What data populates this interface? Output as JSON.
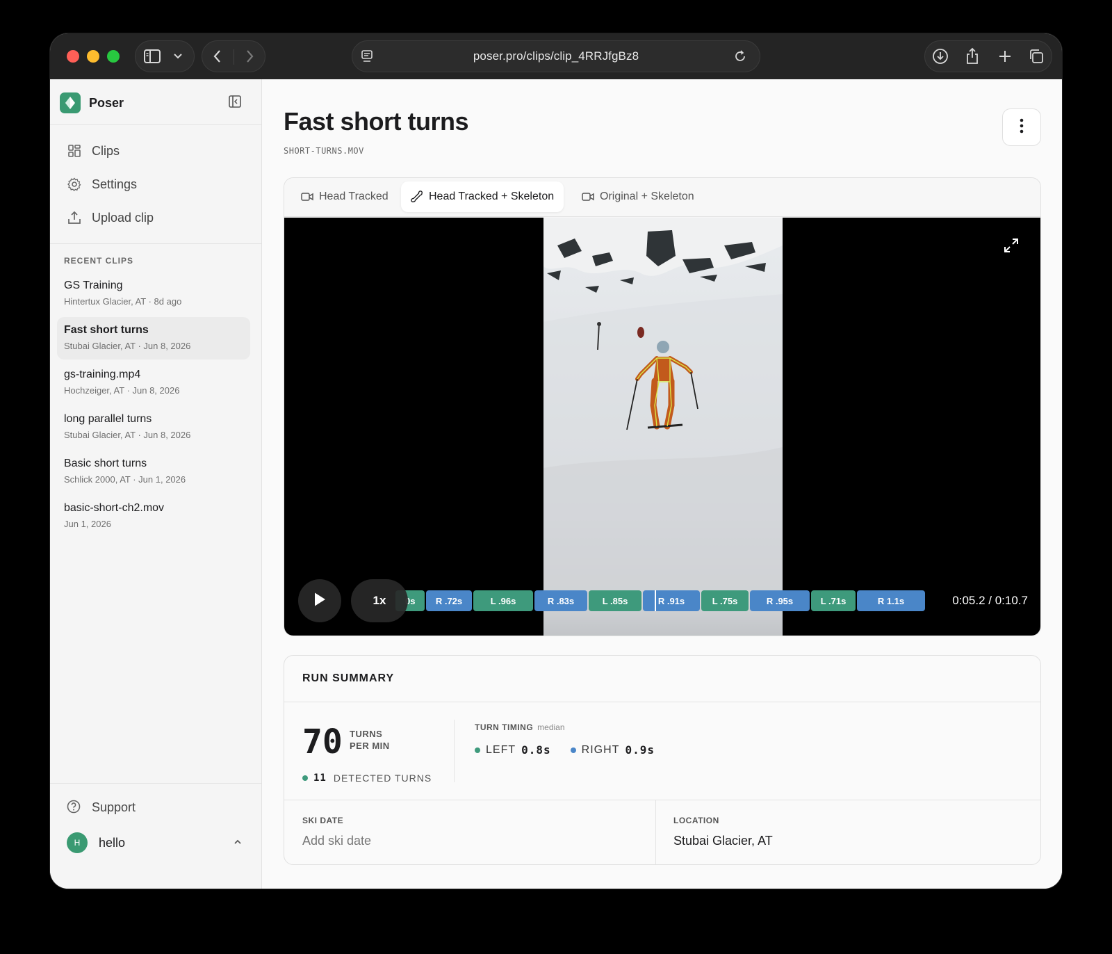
{
  "browser": {
    "url": "poser.pro/clips/clip_4RRJfgBz8"
  },
  "sidebar": {
    "brand": "Poser",
    "nav": [
      {
        "label": "Clips",
        "icon": "grid-icon"
      },
      {
        "label": "Settings",
        "icon": "gear-icon"
      },
      {
        "label": "Upload clip",
        "icon": "upload-icon"
      }
    ],
    "recent_heading": "RECENT CLIPS",
    "recent": [
      {
        "title": "GS Training",
        "sub": "Hintertux Glacier, AT · 8d ago",
        "active": false
      },
      {
        "title": "Fast short turns",
        "sub": "Stubai Glacier, AT · Jun 8, 2026",
        "active": true
      },
      {
        "title": "gs-training.mp4",
        "sub": "Hochzeiger, AT · Jun 8, 2026",
        "active": false
      },
      {
        "title": "long parallel turns",
        "sub": "Stubai Glacier, AT · Jun 8, 2026",
        "active": false
      },
      {
        "title": "Basic short turns",
        "sub": "Schlick 2000, AT · Jun 1, 2026",
        "active": false
      },
      {
        "title": "basic-short-ch2.mov",
        "sub": "Jun 1, 2026",
        "active": false
      }
    ],
    "support": "Support",
    "user": {
      "initial": "H",
      "name": "hello"
    }
  },
  "main": {
    "title": "Fast short turns",
    "filename": "SHORT-TURNS.MOV",
    "tabs": [
      {
        "label": "Head Tracked",
        "icon": "video-camera-icon",
        "active": false
      },
      {
        "label": "Head Tracked + Skeleton",
        "icon": "bone-icon",
        "active": true
      },
      {
        "label": "Original + Skeleton",
        "icon": "video-camera-icon",
        "active": false
      }
    ],
    "player": {
      "speed": "1x",
      "time": "0:05.2 / 0:10.7",
      "turns": [
        {
          "label": "0s",
          "side": "L"
        },
        {
          "label": "R .72s",
          "side": "R"
        },
        {
          "label": "L .96s",
          "side": "L"
        },
        {
          "label": "R .83s",
          "side": "R"
        },
        {
          "label": "L .85s",
          "side": "L"
        },
        {
          "label": "R .91s",
          "side": "R"
        },
        {
          "label": "L .75s",
          "side": "L"
        },
        {
          "label": "R .95s",
          "side": "R"
        },
        {
          "label": "L .71s",
          "side": "L"
        },
        {
          "label": "R 1.1s",
          "side": "R"
        }
      ]
    },
    "summary": {
      "title": "RUN SUMMARY",
      "turns_per_min": "70",
      "unit_line1": "TURNS",
      "unit_line2": "PER MIN",
      "detected_count": "11",
      "detected_label": "DETECTED TURNS",
      "timing_heading": "TURN TIMING",
      "timing_note": "median",
      "left_label": "LEFT",
      "left_value": "0.8s",
      "right_label": "RIGHT",
      "right_value": "0.9s",
      "ski_date_label": "SKI DATE",
      "ski_date_value": "Add ski date",
      "location_label": "LOCATION",
      "location_value": "Stubai Glacier, AT"
    }
  },
  "colors": {
    "brand": "#3a9a72",
    "left_turn": "#3e9a7c",
    "right_turn": "#4a86c8"
  }
}
